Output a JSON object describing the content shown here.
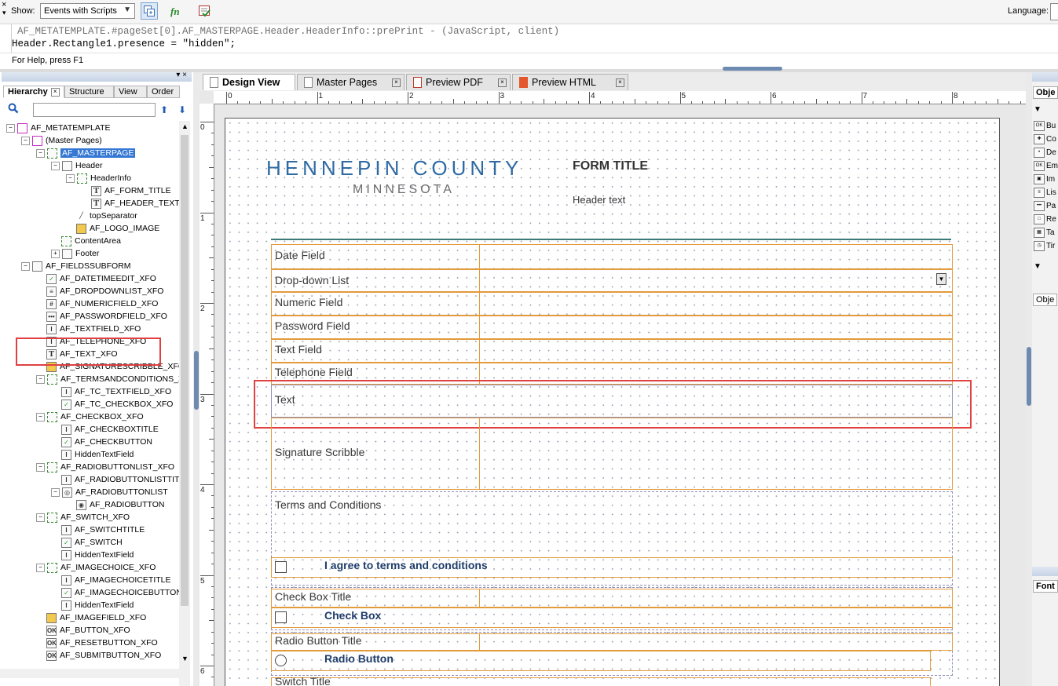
{
  "toolbar": {
    "close_glyph": "×",
    "menu_glyph": "▾",
    "show_label": "Show:",
    "show_value": "Events with Scripts",
    "language_label": "Language:"
  },
  "script": {
    "line1": "AF_METATEMPLATE.#pageSet[0].AF_MASTERPAGE.Header.HeaderInfo::prePrint - (JavaScript, client)",
    "line2": "Header.Rectangle1.presence = \"hidden\";"
  },
  "status": {
    "text": "For Help, press F1"
  },
  "hierarchy": {
    "tabs": [
      "Hierarchy",
      "Structure",
      "View",
      "Order"
    ],
    "nodes": [
      {
        "label": "AF_METATEMPLATE",
        "indent": 0,
        "icon": "pg",
        "exp": "-"
      },
      {
        "label": "(Master Pages)",
        "indent": 1,
        "icon": "pg",
        "exp": "-"
      },
      {
        "label": "AF_MASTERPAGE",
        "indent": 2,
        "icon": "sf",
        "exp": "-",
        "selected": true
      },
      {
        "label": "Header",
        "indent": 3,
        "icon": "",
        "exp": "-"
      },
      {
        "label": "HeaderInfo",
        "indent": 4,
        "icon": "sf",
        "exp": "-"
      },
      {
        "label": "AF_FORM_TITLE",
        "indent": 5,
        "icon": "txt",
        "glyph": "T"
      },
      {
        "label": "AF_HEADER_TEXT",
        "indent": 5,
        "icon": "txt",
        "glyph": "T"
      },
      {
        "label": "topSeparator",
        "indent": 4,
        "icon": "line",
        "glyph": "╱"
      },
      {
        "label": "AF_LOGO_IMAGE",
        "indent": 4,
        "icon": "img"
      },
      {
        "label": "ContentArea",
        "indent": 3,
        "icon": "sf"
      },
      {
        "label": "Footer",
        "indent": 3,
        "icon": "",
        "exp": "+"
      },
      {
        "label": "AF_FIELDSSUBFORM",
        "indent": 1,
        "icon": "",
        "exp": "-"
      },
      {
        "label": "AF_DATETIMEEDIT_XFO",
        "indent": 2,
        "icon": "chk",
        "glyph": "✓"
      },
      {
        "label": "AF_DROPDOWNLIST_XFO",
        "indent": 2,
        "icon": "",
        "glyph": "≡"
      },
      {
        "label": "AF_NUMERICFIELD_XFO",
        "indent": 2,
        "icon": "",
        "glyph": "#"
      },
      {
        "label": "AF_PASSWORDFIELD_XFO",
        "indent": 2,
        "icon": "",
        "glyph": "•••"
      },
      {
        "label": "AF_TEXTFIELD_XFO",
        "indent": 2,
        "icon": "",
        "glyph": "I"
      },
      {
        "label": "AF_TELEPHONE_XFO",
        "indent": 2,
        "icon": "",
        "glyph": "I"
      },
      {
        "label": "AF_TEXT_XFO",
        "indent": 2,
        "icon": "txt",
        "glyph": "T"
      },
      {
        "label": "AF_SIGNATURESCRIBBLE_XFO",
        "indent": 2,
        "icon": "img"
      },
      {
        "label": "AF_TERMSANDCONDITIONS_XF",
        "indent": 2,
        "icon": "sf",
        "exp": "-"
      },
      {
        "label": "AF_TC_TEXTFIELD_XFO",
        "indent": 3,
        "icon": "",
        "glyph": "I"
      },
      {
        "label": "AF_TC_CHECKBOX_XFO",
        "indent": 3,
        "icon": "chk",
        "glyph": "✓"
      },
      {
        "label": "AF_CHECKBOX_XFO",
        "indent": 2,
        "icon": "sf",
        "exp": "-"
      },
      {
        "label": "AF_CHECKBOXTITLE",
        "indent": 3,
        "icon": "",
        "glyph": "I"
      },
      {
        "label": "AF_CHECKBUTTON",
        "indent": 3,
        "icon": "chk",
        "glyph": "✓"
      },
      {
        "label": "HiddenTextField",
        "indent": 3,
        "icon": "",
        "glyph": "I"
      },
      {
        "label": "AF_RADIOBUTTONLIST_XFO",
        "indent": 2,
        "icon": "sf",
        "exp": "-"
      },
      {
        "label": "AF_RADIOBUTTONLISTTITLE",
        "indent": 3,
        "icon": "",
        "glyph": "I"
      },
      {
        "label": "AF_RADIOBUTTONLIST",
        "indent": 3,
        "icon": "",
        "glyph": "◎",
        "exp": "-"
      },
      {
        "label": "AF_RADIOBUTTON",
        "indent": 4,
        "icon": "",
        "glyph": "◉"
      },
      {
        "label": "AF_SWITCH_XFO",
        "indent": 2,
        "icon": "sf",
        "exp": "-"
      },
      {
        "label": "AF_SWITCHTITLE",
        "indent": 3,
        "icon": "",
        "glyph": "I"
      },
      {
        "label": "AF_SWITCH",
        "indent": 3,
        "icon": "chk",
        "glyph": "✓"
      },
      {
        "label": "HiddenTextField",
        "indent": 3,
        "icon": "",
        "glyph": "I"
      },
      {
        "label": "AF_IMAGECHOICE_XFO",
        "indent": 2,
        "icon": "sf",
        "exp": "-"
      },
      {
        "label": "AF_IMAGECHOICETITLE",
        "indent": 3,
        "icon": "",
        "glyph": "I"
      },
      {
        "label": "AF_IMAGECHOICEBUTTON",
        "indent": 3,
        "icon": "chk",
        "glyph": "✓"
      },
      {
        "label": "HiddenTextField",
        "indent": 3,
        "icon": "",
        "glyph": "I"
      },
      {
        "label": "AF_IMAGEFIELD_XFO",
        "indent": 2,
        "icon": "img"
      },
      {
        "label": "AF_BUTTON_XFO",
        "indent": 2,
        "icon": "",
        "glyph": "OK"
      },
      {
        "label": "AF_RESETBUTTON_XFO",
        "indent": 2,
        "icon": "",
        "glyph": "OK"
      },
      {
        "label": "AF_SUBMITBUTTON_XFO",
        "indent": 2,
        "icon": "",
        "glyph": "OK"
      }
    ]
  },
  "doc_tabs": [
    "Design View",
    "Master Pages",
    "Preview PDF",
    "Preview HTML"
  ],
  "ruler": {
    "h": [
      "0",
      "1",
      "2",
      "3",
      "4",
      "5",
      "6",
      "7",
      "8"
    ],
    "v": [
      "0",
      "1",
      "2",
      "3",
      "4",
      "5",
      "6"
    ]
  },
  "form": {
    "logo_main": "HENNEPIN COUNTY",
    "logo_sub": "MINNESOTA",
    "title": "FORM TITLE",
    "header_text": "Header text",
    "fields": {
      "date": "Date Field",
      "dropdown": "Drop-down List",
      "numeric": "Numeric Field",
      "password": "Password Field",
      "text_field": "Text Field",
      "telephone": "Telephone Field",
      "text": "Text",
      "signature": "Signature Scribble",
      "terms": "Terms and Conditions",
      "agree": "I agree to terms and conditions",
      "checkbox_title": "Check Box Title",
      "checkbox": "Check Box",
      "radio_title": "Radio Button Title",
      "radio": "Radio Button",
      "switch_title": "Switch Title"
    }
  },
  "right_panel": {
    "tab_top": "Obje",
    "items": [
      {
        "glyph": "OK",
        "label": "Bu"
      },
      {
        "glyph": "✚",
        "label": "Co"
      },
      {
        "glyph": "•",
        "label": "De"
      },
      {
        "glyph": "OK",
        "label": "Em"
      },
      {
        "glyph": "▣",
        "label": "Im"
      },
      {
        "glyph": "≡",
        "label": "Lis"
      },
      {
        "glyph": "•••",
        "label": "Pa"
      },
      {
        "glyph": "□",
        "label": "Re"
      },
      {
        "glyph": "▦",
        "label": "Ta"
      },
      {
        "glyph": "◷",
        "label": "Tir"
      }
    ],
    "tab_mid": "Obje",
    "tab_font": "Font"
  }
}
